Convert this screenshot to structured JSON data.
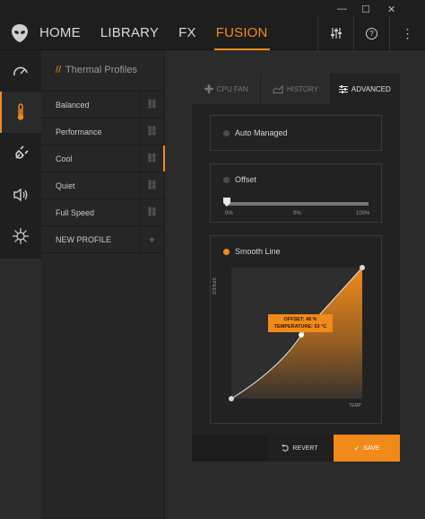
{
  "window": {
    "minimize": "—",
    "maximize": "☐",
    "close": "✕"
  },
  "nav": {
    "items": [
      {
        "label": "HOME"
      },
      {
        "label": "LIBRARY"
      },
      {
        "label": "FX"
      },
      {
        "label": "FUSION"
      }
    ],
    "active": "FUSION"
  },
  "toolbar": {
    "help": "?",
    "more": "⋮"
  },
  "rail": {
    "items": [
      "performance",
      "thermal",
      "power",
      "audio",
      "lighting"
    ],
    "active": "thermal"
  },
  "profiles": {
    "title": "Thermal Profiles",
    "title_prefix": "//",
    "items": [
      {
        "label": "Balanced"
      },
      {
        "label": "Performance"
      },
      {
        "label": "Cool"
      },
      {
        "label": "Quiet"
      },
      {
        "label": "Full Speed"
      }
    ],
    "active": "Cool",
    "new_label": "NEW PROFILE",
    "new_icon": "+"
  },
  "tabs": [
    {
      "label": "CPU FAN"
    },
    {
      "label": "HISTORY"
    },
    {
      "label": "ADVANCED"
    }
  ],
  "active_tab": "ADVANCED",
  "auto_managed": {
    "label": "Auto Managed"
  },
  "offset": {
    "label": "Offset",
    "value_fraction": 0.0,
    "ticks": [
      "0%",
      "0%",
      "100%"
    ]
  },
  "smooth_line": {
    "label": "Smooth Line",
    "y_axis": "SPEED",
    "x_axis": "TEMP",
    "tooltip_offset": "OFFSET: 48 %",
    "tooltip_temp": "TEMPERATURE: 53 °C"
  },
  "footer": {
    "revert": "REVERT",
    "save": "SAVE"
  },
  "colors": {
    "accent": "#f28a1a",
    "bg": "#2b2b2b",
    "panel": "#262626"
  }
}
